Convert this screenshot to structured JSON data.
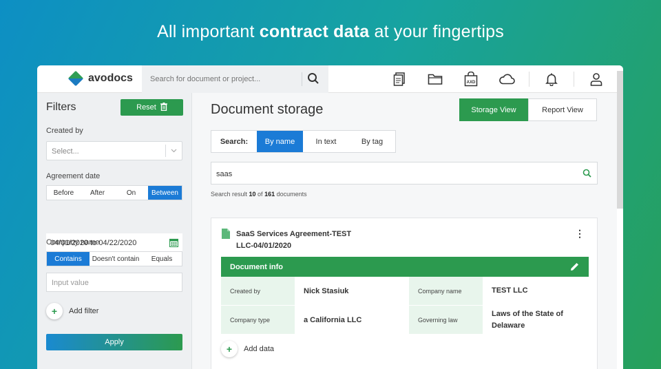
{
  "headline": {
    "pre": "All important ",
    "bold": "contract data",
    "post": " at your fingertips"
  },
  "topbar": {
    "logo_text": "avodocs",
    "search_placeholder": "Search for document or project...",
    "icons": [
      "documents-icon",
      "folder-icon",
      "axd-bag-icon",
      "cloud-icon",
      "bell-icon",
      "user-icon"
    ]
  },
  "sidebar": {
    "title": "Filters",
    "reset_label": "Reset",
    "created_by_label": "Created by",
    "created_by_placeholder": "Select...",
    "agreement_date_label": "Agreement date",
    "date_modes": [
      "Before",
      "After",
      "On",
      "Between"
    ],
    "date_mode_active": "Between",
    "date_range": "04/01/2020 to 04/22/2020",
    "company_name_label": "Company name",
    "company_modes": [
      "Contains",
      "Doesn't contain",
      "Equals"
    ],
    "company_mode_active": "Contains",
    "input_placeholder": "Input value",
    "add_filter_label": "Add filter",
    "apply_label": "Apply"
  },
  "main": {
    "title": "Document storage",
    "views": [
      "Storage View",
      "Report View"
    ],
    "view_active": "Storage View",
    "search_label": "Search:",
    "search_modes": [
      "By name",
      "In text",
      "By tag"
    ],
    "search_mode_active": "By name",
    "query": "saas",
    "result": {
      "prefix": "Search result ",
      "shown": "10",
      "mid": " of ",
      "total": "161",
      "suffix": " documents"
    }
  },
  "card": {
    "title": "SaaS Services Agreement-TEST LLC-04/01/2020",
    "info_header": "Document info",
    "fields": [
      {
        "k1": "Created by",
        "v1": "Nick Stasiuk",
        "k2": "Company name",
        "v2": "TEST LLC"
      },
      {
        "k1": "Company type",
        "v1": "a California LLC",
        "k2": "Governing law",
        "v2": "Laws of the State of Delaware"
      }
    ],
    "add_data_label": "Add data"
  },
  "colors": {
    "green": "#2c9a4f",
    "blue": "#1b7bd6",
    "panel": "#eef0f2"
  }
}
